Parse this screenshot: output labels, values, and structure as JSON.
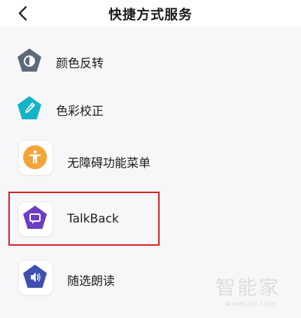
{
  "header": {
    "title": "快捷方式服务"
  },
  "items": [
    {
      "label": "颜色反转",
      "icon": "color-inversion-icon",
      "color": "#5d6b78"
    },
    {
      "label": "色彩校正",
      "icon": "color-correction-icon",
      "color": "#13b4c7"
    },
    {
      "label": "无障碍功能菜单",
      "icon": "accessibility-icon",
      "color": "#f5a43a"
    },
    {
      "label": "TalkBack",
      "icon": "talkback-icon",
      "color": "#6c3ec2"
    },
    {
      "label": "随选朗读",
      "icon": "select-to-speak-icon",
      "color": "#3d4fb0"
    }
  ],
  "watermark": {
    "text": "智能家",
    "url": "www.znj.com"
  }
}
